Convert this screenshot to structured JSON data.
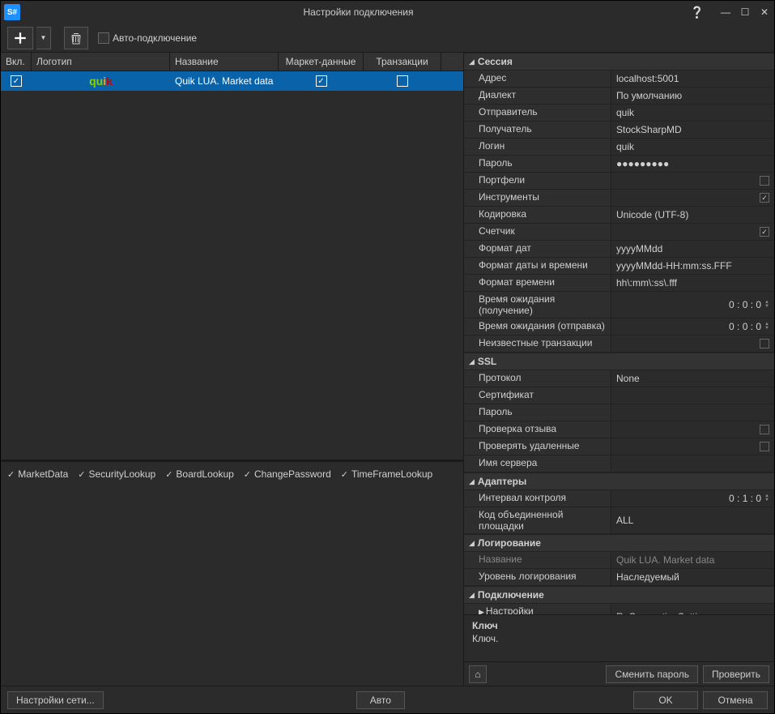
{
  "window": {
    "title": "Настройки подключения"
  },
  "toolbar": {
    "auto_connect_label": "Авто-подключение",
    "auto_connect_checked": false
  },
  "grid": {
    "headers": {
      "enabled": "Вкл.",
      "logo": "Логотип",
      "name": "Название",
      "marketdata": "Маркет-данные",
      "transactions": "Транзакции"
    },
    "rows": [
      {
        "enabled": true,
        "logo": "quik",
        "name": "Quik LUA. Market data",
        "marketdata": true,
        "transactions": false,
        "selected": true
      }
    ]
  },
  "capabilities": [
    "MarketData",
    "SecurityLookup",
    "BoardLookup",
    "ChangePassword",
    "TimeFrameLookup"
  ],
  "properties": {
    "session": {
      "cat": "Сессия",
      "address": {
        "n": "Адрес",
        "v": "localhost:5001"
      },
      "dialect": {
        "n": "Диалект",
        "v": "По умолчанию"
      },
      "sender": {
        "n": "Отправитель",
        "v": "quik"
      },
      "target": {
        "n": "Получатель",
        "v": "StockSharpMD"
      },
      "login": {
        "n": "Логин",
        "v": "quik"
      },
      "password": {
        "n": "Пароль",
        "v": "●●●●●●●●●"
      },
      "portfolios": {
        "n": "Портфели",
        "v": false
      },
      "securities": {
        "n": "Инструменты",
        "v": true
      },
      "encoding": {
        "n": "Кодировка",
        "v": "Unicode (UTF-8)"
      },
      "counter": {
        "n": "Счетчик",
        "v": true
      },
      "dateformat": {
        "n": "Формат дат",
        "v": "yyyyMMdd"
      },
      "datetimeformat": {
        "n": "Формат даты и времени",
        "v": "yyyyMMdd-HH:mm:ss.FFF"
      },
      "timeformat": {
        "n": "Формат времени",
        "v": "hh\\:mm\\:ss\\.fff"
      },
      "recv_timeout": {
        "n": "Время ожидания (получение)",
        "v": "0 : 0 : 0"
      },
      "send_timeout": {
        "n": "Время ожидания (отправка)",
        "v": "0 : 0 : 0"
      },
      "unknown_trans": {
        "n": "Неизвестные транзакции",
        "v": false
      }
    },
    "ssl": {
      "cat": "SSL",
      "protocol": {
        "n": "Протокол",
        "v": "None"
      },
      "cert": {
        "n": "Сертификат",
        "v": ""
      },
      "password": {
        "n": "Пароль",
        "v": ""
      },
      "check_revoke": {
        "n": "Проверка отзыва",
        "v": false
      },
      "check_deleted": {
        "n": "Проверять удаленные",
        "v": false
      },
      "server_name": {
        "n": "Имя сервера",
        "v": ""
      }
    },
    "adapters": {
      "cat": "Адаптеры",
      "heartbeat": {
        "n": "Интервал контроля",
        "v": "0 : 1 : 0"
      },
      "assoc_board": {
        "n": "Код объединенной площадки",
        "v": "ALL"
      }
    },
    "logging": {
      "cat": "Логирование",
      "name": {
        "n": "Название",
        "v": "Quik LUA. Market data"
      },
      "level": {
        "n": "Уровень логирования",
        "v": "Наследуемый"
      }
    },
    "connection": {
      "cat": "Подключение",
      "reconnect": {
        "n": "Настройки переподключения",
        "v": "ReConnectionSettings"
      }
    }
  },
  "description": {
    "title": "Ключ",
    "text": "Ключ."
  },
  "right_buttons": {
    "change_pwd": "Сменить пароль",
    "test": "Проверить"
  },
  "footer": {
    "network": "Настройки сети...",
    "auto": "Авто",
    "ok": "OK",
    "cancel": "Отмена"
  }
}
